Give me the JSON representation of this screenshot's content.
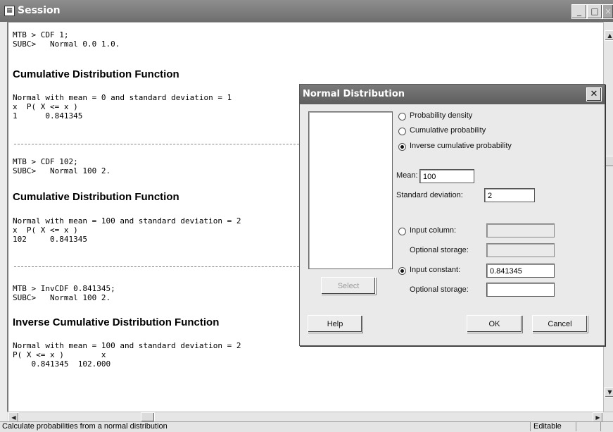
{
  "window": {
    "title": "Session",
    "title_icon": "session-grid-icon",
    "controls": {
      "minimize": "_",
      "maximize": "□",
      "close": "×"
    }
  },
  "session": {
    "block1": {
      "cmd1": "MTB > CDF 1;",
      "cmd2": "SUBC>   Normal 0.0 1.0.",
      "heading": "Cumulative Distribution Function",
      "line1": "Normal with mean = 0 and standard deviation = 1",
      "line2": "x  P( X <= x )",
      "line3": "1      0.841345"
    },
    "block2": {
      "cmd1": "MTB > CDF 102;",
      "cmd2": "SUBC>   Normal 100 2.",
      "heading": "Cumulative Distribution Function",
      "line1": "Normal with mean = 100 and standard deviation = 2",
      "line2": "x  P( X <= x )",
      "line3": "102     0.841345"
    },
    "block3": {
      "cmd1": "MTB > InvCDF 0.841345;",
      "cmd2": "SUBC>   Normal 100 2.",
      "heading": "Inverse Cumulative Distribution Function",
      "line1": "Normal with mean = 100 and standard deviation = 2",
      "line2": "P( X <= x )        x",
      "line3": "    0.841345  102.000"
    }
  },
  "status": {
    "text": "Calculate probabilities from a normal distribution",
    "mode": "Editable"
  },
  "dialog": {
    "title": "Normal Distribution",
    "radio_probability_density": "Probability density",
    "radio_cumulative_probability": "Cumulative probability",
    "radio_inverse_cumulative": "Inverse cumulative probability",
    "selected_mode": "Inverse cumulative probability",
    "mean_label": "Mean:",
    "mean_value": "100",
    "sd_label": "Standard deviation:",
    "sd_value": "2",
    "input_column_label": "Input column:",
    "input_column_value": "",
    "optional_storage_label_1": "Optional storage:",
    "optional_storage_value_1": "",
    "input_constant_label": "Input constant:",
    "input_constant_value": "0.841345",
    "optional_storage_label_2": "Optional storage:",
    "optional_storage_value_2": "",
    "select_button": "Select",
    "help_button": "Help",
    "ok_button": "OK",
    "cancel_button": "Cancel",
    "selected_input": "Input constant"
  }
}
